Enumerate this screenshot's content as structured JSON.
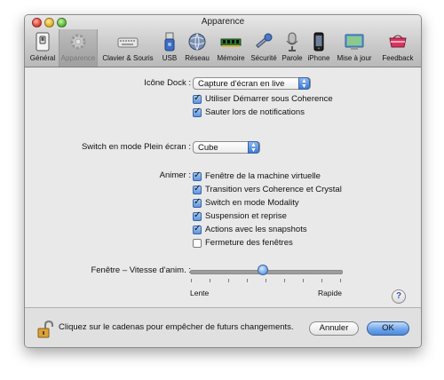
{
  "window": {
    "title": "Apparence"
  },
  "toolbar": {
    "items": [
      {
        "label": "Général",
        "icon": "general-switch-icon"
      },
      {
        "label": "Apparence",
        "icon": "appearance-gear-icon"
      },
      {
        "label": "Clavier & Souris",
        "icon": "keyboard-icon"
      },
      {
        "label": "USB",
        "icon": "usb-icon"
      },
      {
        "label": "Réseau",
        "icon": "network-globe-icon"
      },
      {
        "label": "Mémoire",
        "icon": "memory-chip-icon"
      },
      {
        "label": "Sécurité",
        "icon": "security-key-icon"
      },
      {
        "label": "Parole",
        "icon": "microphone-icon"
      },
      {
        "label": "iPhone",
        "icon": "iphone-icon"
      },
      {
        "label": "Mise à jour",
        "icon": "update-icon"
      },
      {
        "label": "Feedback",
        "icon": "feedback-icon"
      }
    ]
  },
  "dock": {
    "label": "Icône Dock :",
    "value": "Capture d'écran en live",
    "options": [
      {
        "label": "Utiliser Démarrer sous Coherence",
        "checked": true
      },
      {
        "label": "Sauter lors de notifications",
        "checked": true
      }
    ]
  },
  "fullscreen": {
    "label": "Switch en mode Plein écran :",
    "value": "Cube"
  },
  "animate": {
    "label": "Animer :",
    "options": [
      {
        "label": "Fenêtre de la machine virtuelle",
        "checked": true
      },
      {
        "label": "Transition vers Coherence et Crystal",
        "checked": true
      },
      {
        "label": "Switch en mode Modality",
        "checked": true
      },
      {
        "label": "Suspension et reprise",
        "checked": true
      },
      {
        "label": "Actions avec les snapshots",
        "checked": true
      },
      {
        "label": "Fermeture des fenêtres",
        "checked": false
      }
    ]
  },
  "speed": {
    "label": "Fenêtre – Vitesse d'anim. :",
    "min_label": "Lente",
    "max_label": "Rapide",
    "value_fraction": 0.48
  },
  "help": {
    "symbol": "?"
  },
  "bottom": {
    "lock_text": "Cliquez sur le cadenas pour empêcher de futurs changements.",
    "cancel_label": "Annuler",
    "ok_label": "OK"
  },
  "colors": {
    "accent": "#5b95de",
    "window_bg": "#e9e9e9"
  }
}
